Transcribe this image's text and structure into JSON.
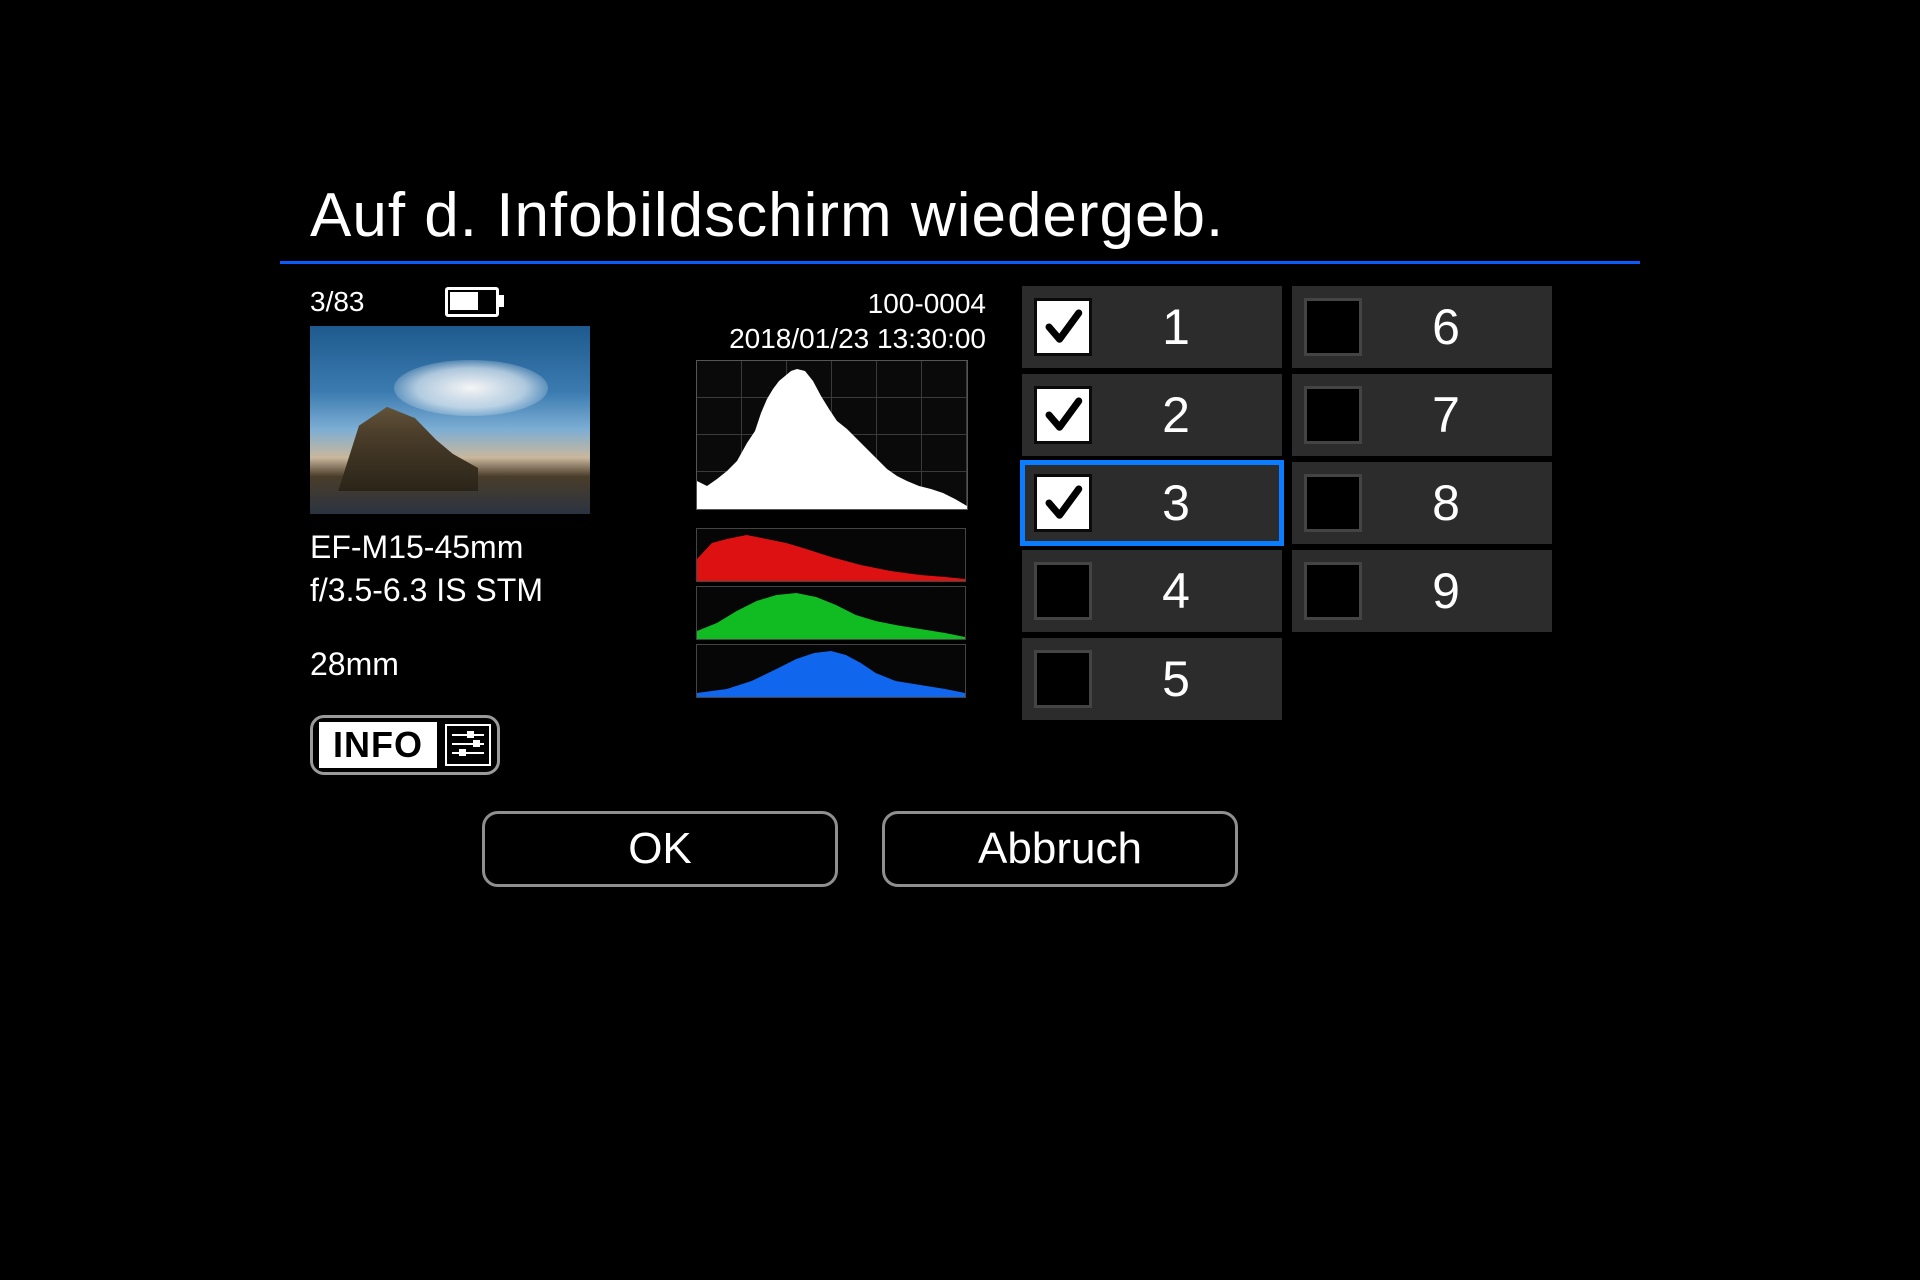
{
  "title": "Auf d. Infobildschirm wiedergeb.",
  "preview": {
    "counter": "3/83",
    "lens_line1": "EF-M15-45mm",
    "lens_line2": "f/3.5-6.3 IS STM",
    "focal_length": "28mm",
    "info_badge": "INFO"
  },
  "meta": {
    "file_number": "100-0004",
    "datetime": "2018/01/23 13:30:00"
  },
  "options": [
    {
      "num": "1",
      "checked": true,
      "selected": false
    },
    {
      "num": "2",
      "checked": true,
      "selected": false
    },
    {
      "num": "3",
      "checked": true,
      "selected": true
    },
    {
      "num": "4",
      "checked": false,
      "selected": false
    },
    {
      "num": "5",
      "checked": false,
      "selected": false
    },
    {
      "num": "6",
      "checked": false,
      "selected": false
    },
    {
      "num": "7",
      "checked": false,
      "selected": false
    },
    {
      "num": "8",
      "checked": false,
      "selected": false
    },
    {
      "num": "9",
      "checked": false,
      "selected": false
    }
  ],
  "buttons": {
    "ok": "OK",
    "cancel": "Abbruch"
  }
}
